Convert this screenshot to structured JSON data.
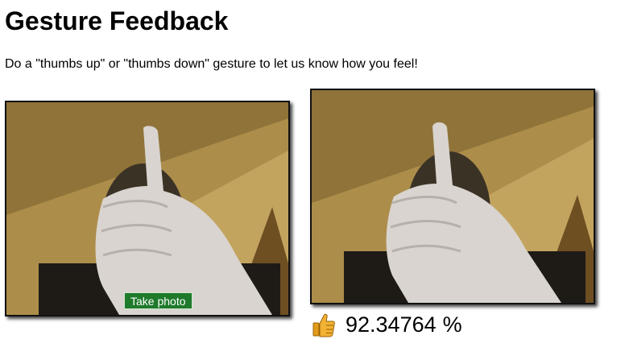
{
  "page": {
    "title": "Gesture Feedback",
    "instructions": "Do a \"thumbs up\" or \"thumbs down\" gesture to let us know how you feel!"
  },
  "webcam": {
    "take_photo_label": "Take photo"
  },
  "result": {
    "gesture_icon": "thumbs-up-icon",
    "confidence": "92.34764",
    "unit": "%"
  },
  "colors": {
    "button_bg": "#1f7a2c",
    "frame_border": "#111111",
    "thumb_icon": "#f2b233"
  }
}
